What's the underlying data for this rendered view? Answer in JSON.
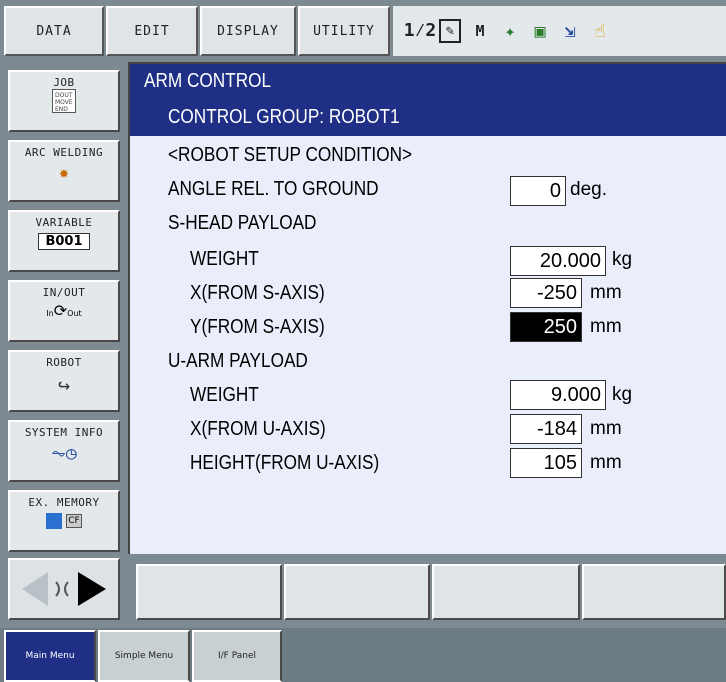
{
  "top_menu": {
    "data": "DATA",
    "edit": "EDIT",
    "display": "DISPLAY",
    "utility": "UTILITY"
  },
  "status_icons": [
    "axis-order-icon",
    "edit-mode-icon",
    "teach-mode-icon",
    "coordinate-icon",
    "tool-icon",
    "jog-icon",
    "hand-icon"
  ],
  "side_menu": {
    "job": {
      "label": "JOB",
      "icon_lines": [
        "DOUT",
        "MOVE",
        "END"
      ]
    },
    "arc_welding": {
      "label": "ARC WELDING"
    },
    "variable": {
      "label": "VARIABLE",
      "badge": "B001"
    },
    "in_out": {
      "label": "IN/OUT",
      "in": "In",
      "out": "Out"
    },
    "robot": {
      "label": "ROBOT"
    },
    "system_info": {
      "label": "SYSTEM INFO"
    },
    "ex_memory": {
      "label": "EX. MEMORY",
      "cf": "CF"
    }
  },
  "screen": {
    "title": "ARM CONTROL",
    "control_group": "CONTROL GROUP: ROBOT1",
    "section_setup": "<ROBOT SETUP CONDITION>",
    "angle_label": "ANGLE REL. TO GROUND",
    "angle_value": "0",
    "angle_unit": "deg.",
    "shead_title": "S-HEAD PAYLOAD",
    "shead_weight_label": "WEIGHT",
    "shead_weight_value": "20.000",
    "shead_weight_unit": "kg",
    "shead_x_label": "X(FROM S-AXIS)",
    "shead_x_value": "-250",
    "shead_x_unit": "mm",
    "shead_y_label": "Y(FROM S-AXIS)",
    "shead_y_value": "250",
    "shead_y_unit": "mm",
    "uarm_title": "U-ARM PAYLOAD",
    "uarm_weight_label": "WEIGHT",
    "uarm_weight_value": "9.000",
    "uarm_weight_unit": "kg",
    "uarm_x_label": "X(FROM U-AXIS)",
    "uarm_x_value": "-184",
    "uarm_x_unit": "mm",
    "uarm_h_label": "HEIGHT(FROM U-AXIS)",
    "uarm_h_value": "105",
    "uarm_h_unit": "mm"
  },
  "bottom_tabs": {
    "main_menu": "Main Menu",
    "simple_menu": "Simple Menu",
    "if_panel": "I/F Panel"
  }
}
